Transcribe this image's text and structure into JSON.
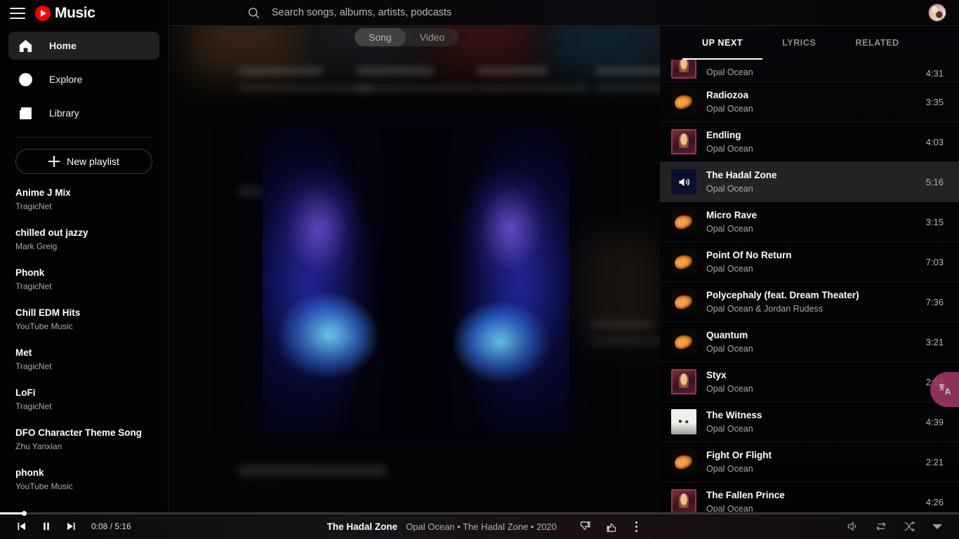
{
  "app": {
    "brand_name": "Music",
    "logo_icon": "youtube-play-icon",
    "menu_icon": "hamburger-menu-icon"
  },
  "search": {
    "placeholder": "Search songs, albums, artists, podcasts",
    "value": "",
    "icon": "search-icon"
  },
  "account": {
    "avatar_icon": "avatar"
  },
  "sidebar": {
    "nav": [
      {
        "label": "Home",
        "icon": "home-icon",
        "active": true
      },
      {
        "label": "Explore",
        "icon": "compass-icon",
        "active": false
      },
      {
        "label": "Library",
        "icon": "library-music-icon",
        "active": false
      }
    ],
    "new_playlist_label": "New playlist",
    "new_playlist_icon": "plus-icon",
    "playlists": [
      {
        "title": "Anime J Mix",
        "owner": "TragicNet"
      },
      {
        "title": "chilled out jazzy",
        "owner": "Mark Greig"
      },
      {
        "title": "Phonk",
        "owner": "TragicNet"
      },
      {
        "title": "Chill EDM Hits",
        "owner": "YouTube Music"
      },
      {
        "title": "Met",
        "owner": "TragicNet"
      },
      {
        "title": "LoFi",
        "owner": "TragicNet"
      },
      {
        "title": "DFO Character Theme Song",
        "owner": "Zhu Yanxian"
      },
      {
        "title": "phonk",
        "owner": "YouTube Music"
      }
    ]
  },
  "media_toggle": {
    "song_label": "Song",
    "video_label": "Video",
    "selected": "Song"
  },
  "queue": {
    "tabs": [
      {
        "label": "UP NEXT",
        "active": true
      },
      {
        "label": "LYRICS",
        "active": false
      },
      {
        "label": "RELATED",
        "active": false
      }
    ],
    "items": [
      {
        "title": "",
        "artist": "Opal Ocean",
        "duration": "4:31",
        "thumb": "thumb-a",
        "current": false,
        "partial": true
      },
      {
        "title": "Radiozoa",
        "artist": "Opal Ocean",
        "duration": "3:35",
        "thumb": "thumb-b",
        "current": false,
        "partial": false
      },
      {
        "title": "Endling",
        "artist": "Opal Ocean",
        "duration": "4:03",
        "thumb": "thumb-a",
        "current": false,
        "partial": false
      },
      {
        "title": "The Hadal Zone",
        "artist": "Opal Ocean",
        "duration": "5:16",
        "thumb": "thumb-now",
        "current": true,
        "partial": false
      },
      {
        "title": "Micro Rave",
        "artist": "Opal Ocean",
        "duration": "3:15",
        "thumb": "thumb-b",
        "current": false,
        "partial": false
      },
      {
        "title": "Point Of No Return",
        "artist": "Opal Ocean",
        "duration": "7:03",
        "thumb": "thumb-b",
        "current": false,
        "partial": false
      },
      {
        "title": "Polycephaly (feat. Dream Theater)",
        "artist": "Opal Ocean & Jordan Rudess",
        "duration": "7:36",
        "thumb": "thumb-b",
        "current": false,
        "partial": false
      },
      {
        "title": "Quantum",
        "artist": "Opal Ocean",
        "duration": "3:21",
        "thumb": "thumb-b",
        "current": false,
        "partial": false
      },
      {
        "title": "Styx",
        "artist": "Opal Ocean",
        "duration": "2:13",
        "thumb": "thumb-a",
        "current": false,
        "partial": false
      },
      {
        "title": "The Witness",
        "artist": "Opal Ocean",
        "duration": "4:39",
        "thumb": "thumb-c",
        "current": false,
        "partial": false
      },
      {
        "title": "Fight Or Flight",
        "artist": "Opal Ocean",
        "duration": "2:21",
        "thumb": "thumb-b",
        "current": false,
        "partial": false
      },
      {
        "title": "The Fallen Prince",
        "artist": "Opal Ocean",
        "duration": "4:26",
        "thumb": "thumb-a",
        "current": false,
        "partial": false
      }
    ]
  },
  "translate": {
    "icon": "translate-icon",
    "color": "#a6386a"
  },
  "player": {
    "previous_icon": "previous-track-icon",
    "play_pause_icon": "pause-icon",
    "next_icon": "next-track-icon",
    "elapsed": "0:08",
    "duration": "5:16",
    "time_display": "0:08 / 5:16",
    "progress_percent": 2.5,
    "now_playing_title": "The Hadal Zone",
    "now_playing_subtitle": "Opal Ocean • The Hadal Zone • 2020",
    "dislike_icon": "thumb-down-icon",
    "like_icon": "thumb-up-icon",
    "more_icon": "more-vertical-icon",
    "volume_icon": "volume-icon",
    "repeat_icon": "repeat-icon",
    "shuffle_icon": "shuffle-icon",
    "expand_icon": "chevron-down-icon"
  }
}
